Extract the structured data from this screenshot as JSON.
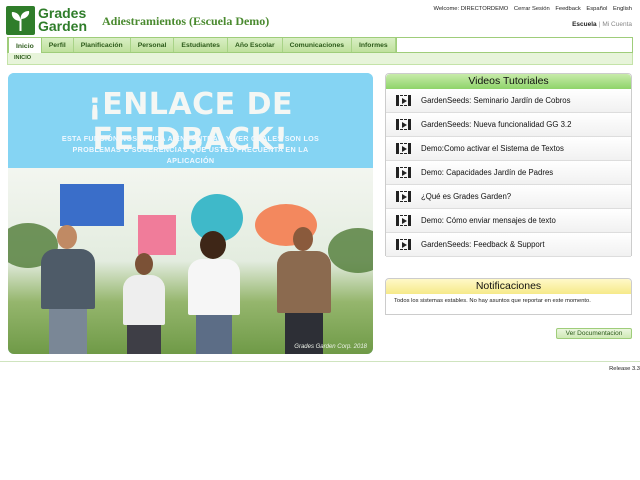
{
  "header": {
    "logo_line1": "Grades",
    "logo_line2": "Garden",
    "org_title": "Adiestramientos (Escuela Demo)",
    "welcome": "Welcome: DIRECTORDEMO",
    "logout": "Cerrar Sesión",
    "feedback": "Feedback",
    "lang_es": "Español",
    "lang_en": "English",
    "school": "Escuela",
    "separator": "|",
    "my_account": "Mi Cuenta"
  },
  "nav": {
    "tabs": [
      {
        "label": "Inicio"
      },
      {
        "label": "Perfil"
      },
      {
        "label": "Planificación"
      },
      {
        "label": "Personal"
      },
      {
        "label": "Estudiantes"
      },
      {
        "label": "Año Escolar"
      },
      {
        "label": "Comunicaciones"
      },
      {
        "label": "Informes"
      }
    ],
    "subnav": "INICIO"
  },
  "banner": {
    "title": "¡ENLACE DE FEEDBACK!",
    "subtitle": "ESTA FUNCIÓN NOS AYUDA A ENCONTRAR Y VER CUALES SON LOS PROBLEMAS O SUGERENCIAS QUE USTED FRECUENTA EN LA APLICACIÓN",
    "watermark": "Grades Garden Corp. 2018"
  },
  "videos": {
    "title": "Videos Tutoriales",
    "items": [
      {
        "label": "GardenSeeds: Seminario Jardín de Cobros"
      },
      {
        "label": "GardenSeeds: Nueva funcionalidad GG 3.2"
      },
      {
        "label": "Demo:Como activar el Sistema de Textos"
      },
      {
        "label": "Demo: Capacidades Jardín de Padres"
      },
      {
        "label": "¿Qué es Grades Garden?"
      },
      {
        "label": "Demo: Cómo enviar mensajes de texto"
      },
      {
        "label": "GardenSeeds: Feedback & Support"
      }
    ]
  },
  "notifications": {
    "title": "Notificaciones",
    "message": "Todos los sistemas estables. No hay asuntos que reportar en este momento."
  },
  "doc_button": "Ver Documentacion",
  "release": "Release 3.3",
  "colors": {
    "brand_green": "#2f7d2a",
    "nav_green": "#bfe19d",
    "video_header": "#8ed46a",
    "notif_header": "#f6ea8a",
    "banner_blue": "#85d4f3"
  }
}
